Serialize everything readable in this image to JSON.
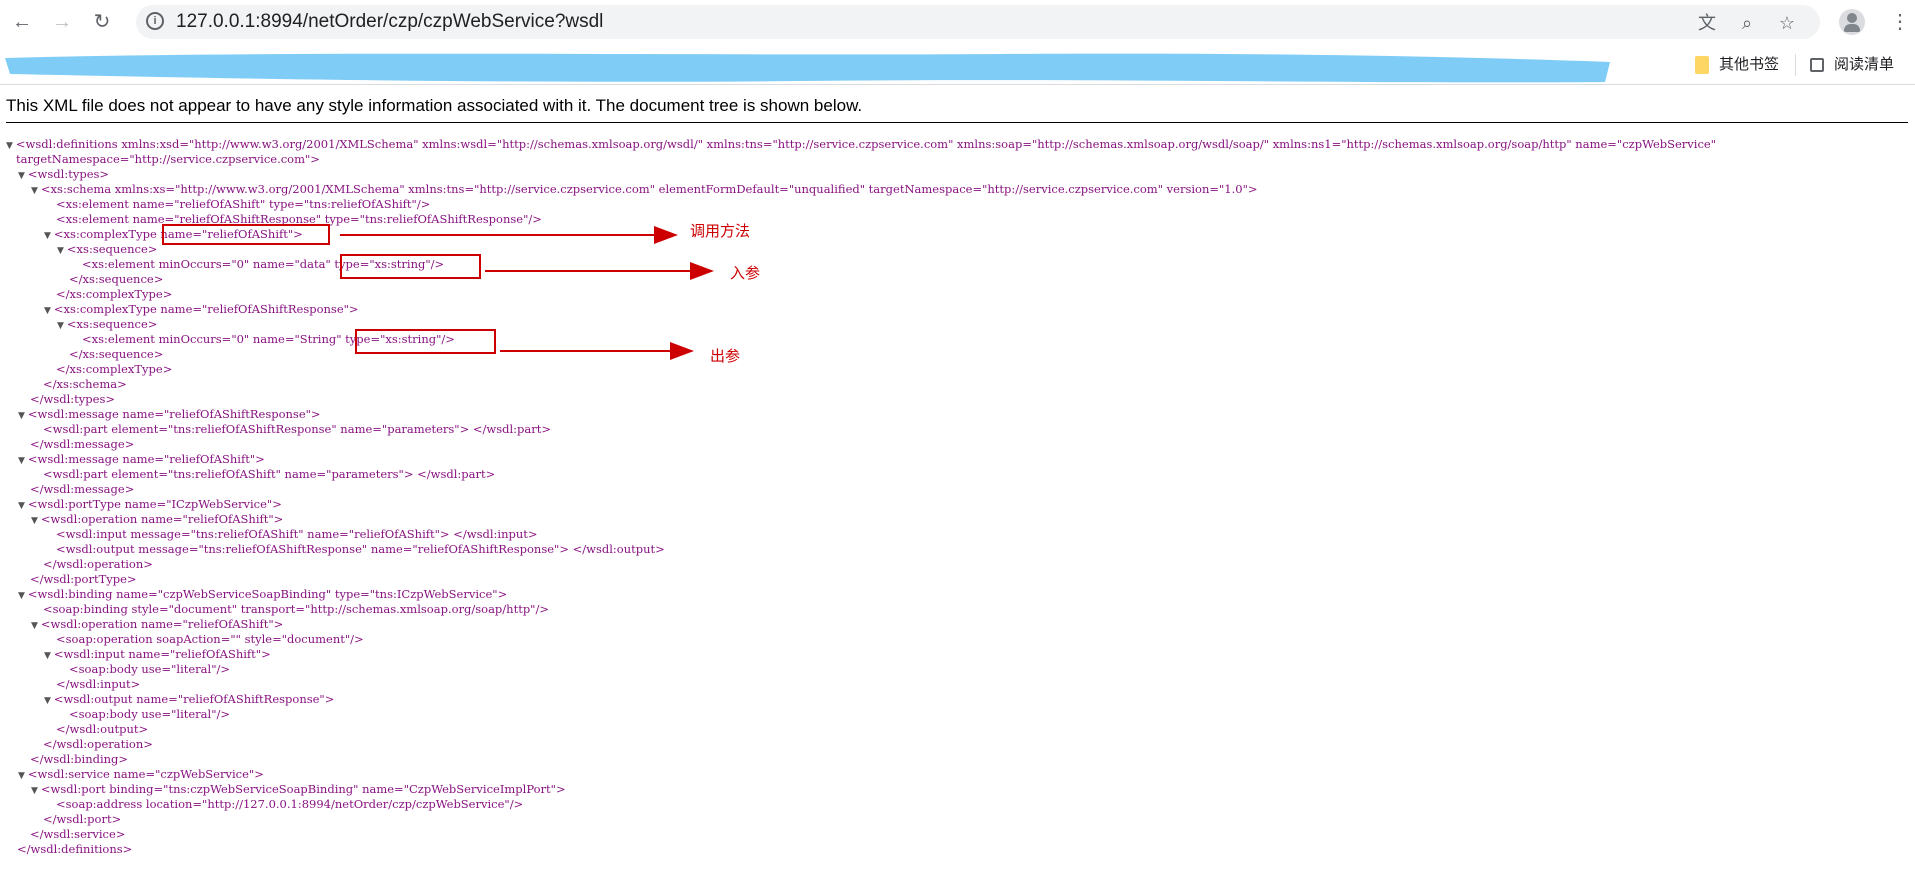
{
  "browser": {
    "url": "127.0.0.1:8994/netOrder/czp/czpWebService?wsdl",
    "icons": [
      "back-icon",
      "forward-icon",
      "reload-icon",
      "info-icon",
      "translate-icon",
      "zoom-icon",
      "star-icon",
      "avatar-icon",
      "menu-icon"
    ]
  },
  "bookmarks": {
    "other": "其他书签",
    "reading_list": "阅读清单"
  },
  "notice": "This XML file does not appear to have any style information associated with it. The document tree is shown below.",
  "annotations": {
    "method": "调用方法",
    "input": "入参",
    "output": "出参",
    "color": "#cc0000"
  },
  "xml": {
    "l0": "<wsdl:definitions xmlns:xsd=\"http://www.w3.org/2001/XMLSchema\" xmlns:wsdl=\"http://schemas.xmlsoap.org/wsdl/\" xmlns:tns=\"http://service.czpservice.com\" xmlns:soap=\"http://schemas.xmlsoap.org/wsdl/soap/\" xmlns:ns1=\"http://schemas.xmlsoap.org/soap/http\" name=\"czpWebService\"",
    "l1": "targetNamespace=\"http://service.czpservice.com\">",
    "l2": "<wsdl:types>",
    "l3": "<xs:schema xmlns:xs=\"http://www.w3.org/2001/XMLSchema\" xmlns:tns=\"http://service.czpservice.com\" elementFormDefault=\"unqualified\" targetNamespace=\"http://service.czpservice.com\" version=\"1.0\">",
    "l4": "<xs:element name=\"reliefOfAShift\" type=\"tns:reliefOfAShift\"/>",
    "l5": "<xs:element name=\"reliefOfAShiftResponse\" type=\"tns:reliefOfAShiftResponse\"/>",
    "l6a": "<xs:complexType ",
    "l6b": "name=\"reliefOfAShift\">",
    "l7": "<xs:sequence>",
    "l8a": "<xs:element minOccurs=\"0\" name=\"data\" ",
    "l8b": "type=\"xs:string\"/>",
    "l9": "</xs:sequence>",
    "l10": "</xs:complexType>",
    "l11": "<xs:complexType name=\"reliefOfAShiftResponse\">",
    "l12": "<xs:sequence>",
    "l13a": "<xs:element minOccurs=\"0\" name=\"String\" ",
    "l13b": "type=\"xs:string\"/>",
    "l14": "</xs:sequence>",
    "l15": "</xs:complexType>",
    "l16": "</xs:schema>",
    "l17": "</wsdl:types>",
    "l18": "<wsdl:message name=\"reliefOfAShiftResponse\">",
    "l19": "<wsdl:part element=\"tns:reliefOfAShiftResponse\" name=\"parameters\"> </wsdl:part>",
    "l20": "</wsdl:message>",
    "l21": "<wsdl:message name=\"reliefOfAShift\">",
    "l22": "<wsdl:part element=\"tns:reliefOfAShift\" name=\"parameters\"> </wsdl:part>",
    "l23": "</wsdl:message>",
    "l24": "<wsdl:portType name=\"ICzpWebService\">",
    "l25": "<wsdl:operation name=\"reliefOfAShift\">",
    "l26": "<wsdl:input message=\"tns:reliefOfAShift\" name=\"reliefOfAShift\"> </wsdl:input>",
    "l27": "<wsdl:output message=\"tns:reliefOfAShiftResponse\" name=\"reliefOfAShiftResponse\"> </wsdl:output>",
    "l28": "</wsdl:operation>",
    "l29": "</wsdl:portType>",
    "l30": "<wsdl:binding name=\"czpWebServiceSoapBinding\" type=\"tns:ICzpWebService\">",
    "l31": "<soap:binding style=\"document\" transport=\"http://schemas.xmlsoap.org/soap/http\"/>",
    "l32": "<wsdl:operation name=\"reliefOfAShift\">",
    "l33": "<soap:operation soapAction=\"\" style=\"document\"/>",
    "l34": "<wsdl:input name=\"reliefOfAShift\">",
    "l35": "<soap:body use=\"literal\"/>",
    "l36": "</wsdl:input>",
    "l37": "<wsdl:output name=\"reliefOfAShiftResponse\">",
    "l38": "<soap:body use=\"literal\"/>",
    "l39": "</wsdl:output>",
    "l40": "</wsdl:operation>",
    "l41": "</wsdl:binding>",
    "l42": "<wsdl:service name=\"czpWebService\">",
    "l43": "<wsdl:port binding=\"tns:czpWebServiceSoapBinding\" name=\"CzpWebServiceImplPort\">",
    "l44": "<soap:address location=\"http://127.0.0.1:8994/netOrder/czp/czpWebService\"/>",
    "l45": "</wsdl:port>",
    "l46": "</wsdl:service>",
    "l47": "</wsdl:definitions>"
  }
}
